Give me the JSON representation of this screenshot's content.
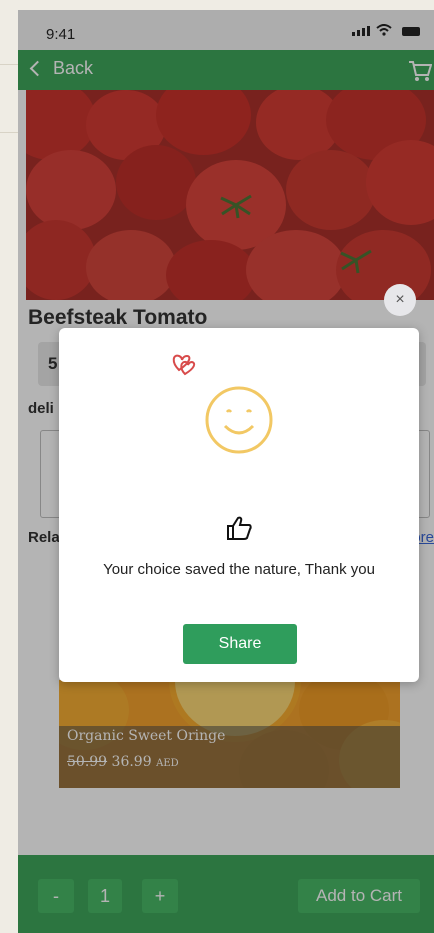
{
  "status_bar": {
    "time": "9:41"
  },
  "header": {
    "back_label": "Back"
  },
  "product": {
    "title": "Beefsteak Tomato",
    "price_partial": "5"
  },
  "sections": {
    "delivery_label_partial": "deli",
    "related_label_partial": "Rela",
    "more_link_partial": "ore"
  },
  "related_item": {
    "name": "Organic Sweet Oringe",
    "old_price": "50.99",
    "price": "36.99",
    "currency": "AED"
  },
  "bottom_bar": {
    "minus_label": "-",
    "quantity": "1",
    "plus_label": "+",
    "add_to_cart_label": "Add to Cart"
  },
  "modal": {
    "close_label": "×",
    "message": "Your choice saved the nature, Thank you",
    "share_label": "Share"
  },
  "colors": {
    "primary_green": "#2e9e4d",
    "share_green": "#2f9d5c",
    "smile_yellow": "#f2c864",
    "hearts_red": "#d84b4b"
  }
}
